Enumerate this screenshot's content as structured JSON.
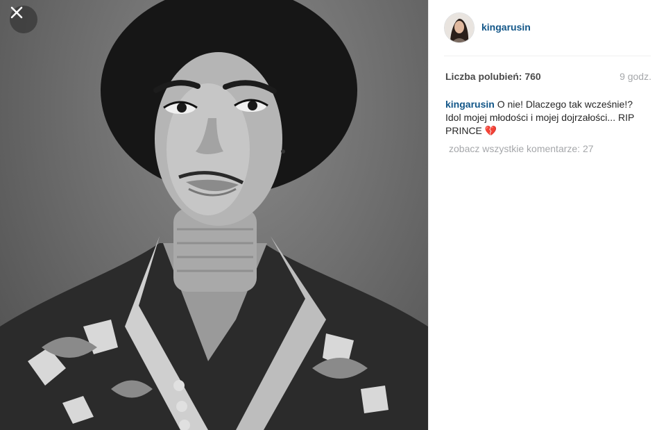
{
  "post": {
    "username": "kingarusin",
    "likes_label": "Liczba polubień: 760",
    "time_ago": "9 godz.",
    "caption": {
      "username": "kingarusin",
      "text": "O nie! Dlaczego tak wcześnie!? Idol mojej młodości i mojej dojrzałości... RIP PRINCE",
      "emoji": "💔"
    },
    "view_comments": "zobacz wszystkie komentarze: 27"
  },
  "icons": {
    "close": "close-icon",
    "avatar": "avatar",
    "broken_heart": "broken-heart-icon"
  },
  "colors": {
    "username": "#125688",
    "muted": "#a5a7aa",
    "close_bg": "#3c3c3c"
  }
}
